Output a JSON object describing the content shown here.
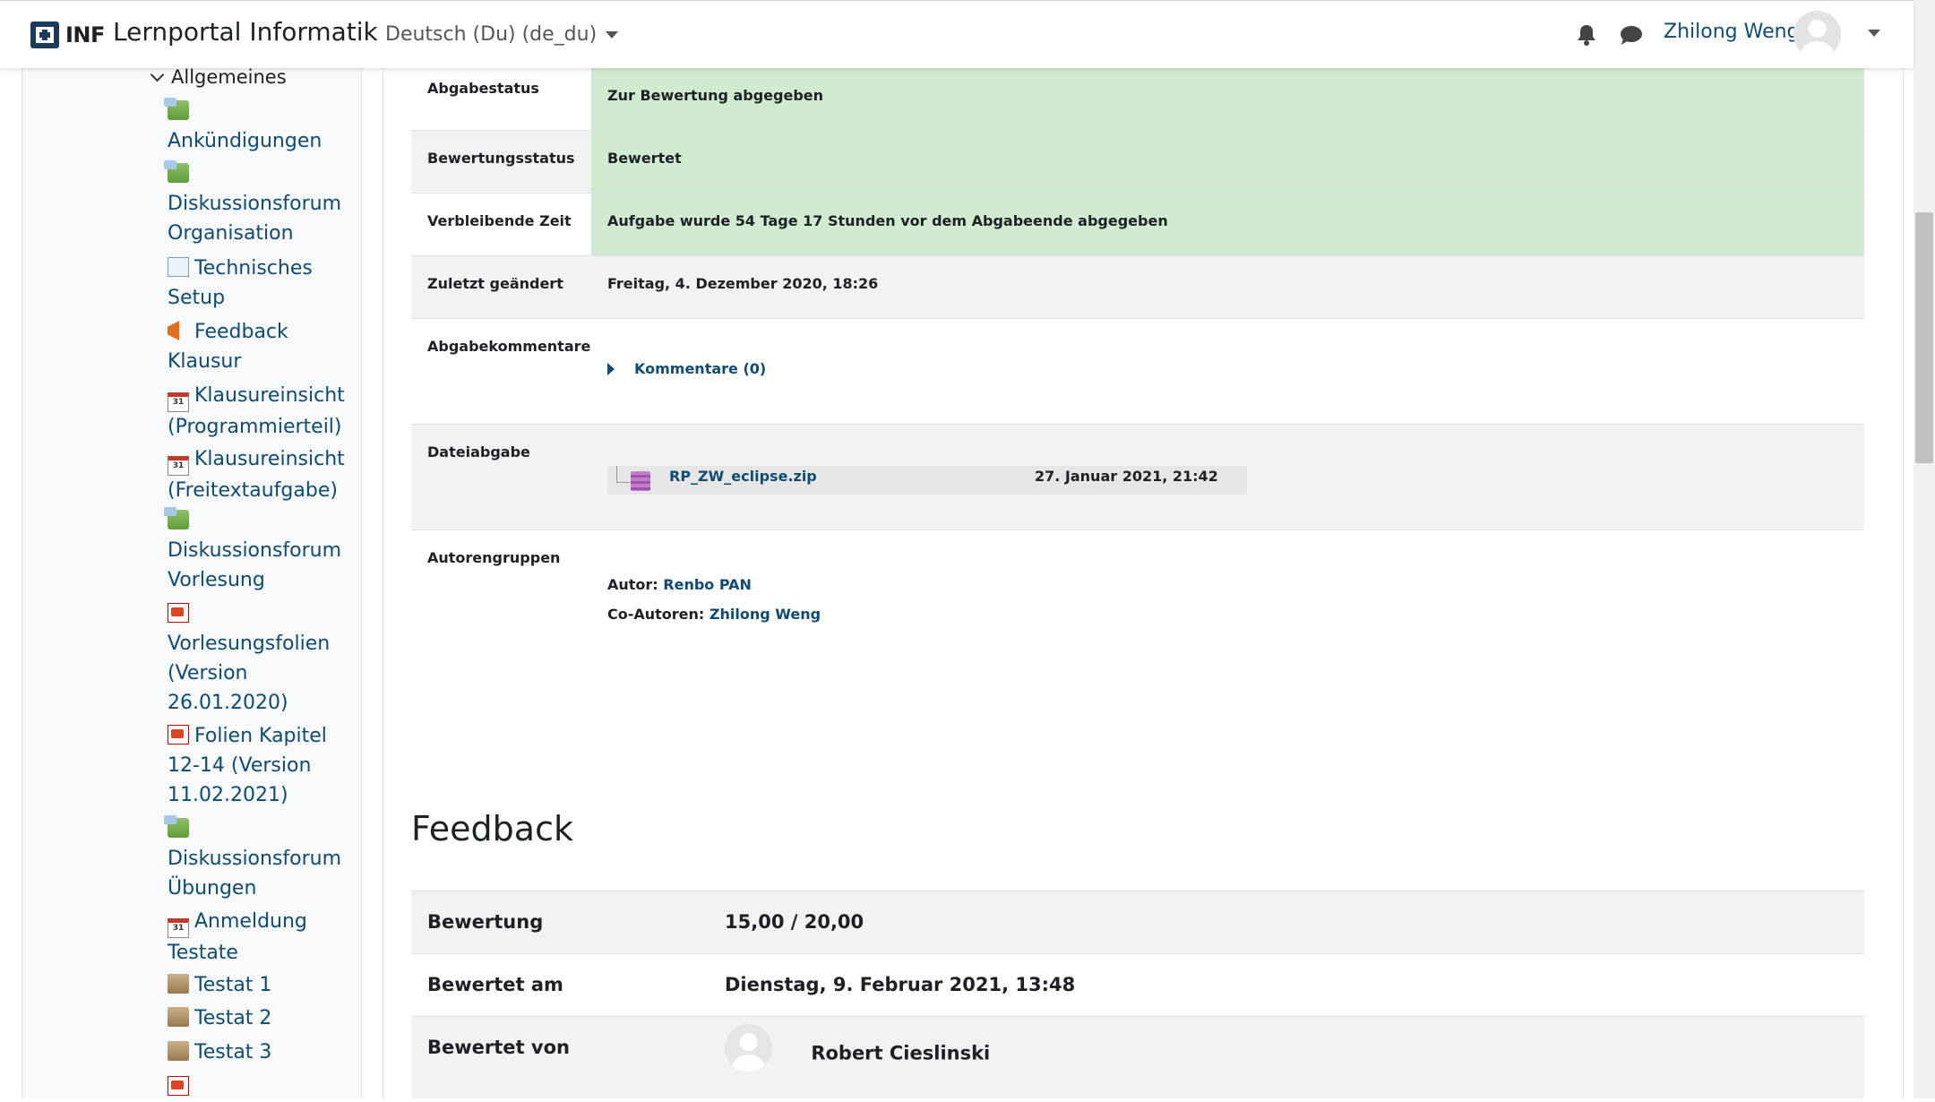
{
  "header": {
    "logo_text": "INF",
    "site_name": "Lernportal Informatik",
    "language": "Deutsch (Du) (de_du)",
    "user_name": "Zhilong Weng"
  },
  "sidebar": {
    "section": "Allgemeines",
    "items": [
      {
        "label": "Ankündigungen",
        "icon": "forum-icon"
      },
      {
        "label": "Diskussionsforum Organisation",
        "icon": "forum-icon"
      },
      {
        "label": "Technisches Setup",
        "icon": "choice-icon"
      },
      {
        "label": "Feedback Klausur",
        "icon": "feedback-icon"
      },
      {
        "label": "Klausureinsicht (Programmierteil)",
        "icon": "calendar-icon"
      },
      {
        "label": "Klausureinsicht (Freitextaufgabe)",
        "icon": "calendar-icon"
      },
      {
        "label": "Diskussionsforum Vorlesung",
        "icon": "forum-icon"
      },
      {
        "label": "Vorlesungsfolien (Version 26.01.2020)",
        "icon": "pdf-icon"
      },
      {
        "label": "Folien Kapitel 12-14 (Version 11.02.2021)",
        "icon": "pdf-icon"
      },
      {
        "label": "Diskussionsforum Übungen",
        "icon": "forum-icon"
      },
      {
        "label": "Anmeldung Testate",
        "icon": "calendar-icon"
      },
      {
        "label": "Testat 1",
        "icon": "quiz-icon"
      },
      {
        "label": "Testat 2",
        "icon": "quiz-icon"
      },
      {
        "label": "Testat 3",
        "icon": "quiz-icon"
      }
    ]
  },
  "submission": {
    "status_label": "Abgabestatus",
    "status_value": "Zur Bewertung abgegeben",
    "grading_label": "Bewertungsstatus",
    "grading_value": "Bewertet",
    "time_label": "Verbleibende Zeit",
    "time_value": "Aufgabe wurde 54 Tage 17 Stunden vor dem Abgabeende abgegeben",
    "modified_label": "Zuletzt geändert",
    "modified_value": "Freitag, 4. Dezember 2020, 18:26",
    "comments_label": "Abgabekommentare",
    "comments_link": "Kommentare (0)",
    "file_label": "Dateiabgabe",
    "file_name": "RP_ZW_eclipse.zip",
    "file_date": "27. Januar 2021, 21:42",
    "groups_label": "Autorengruppen",
    "author_prefix": "Autor:",
    "author_name": "Renbo PAN",
    "coauthor_prefix": "Co-Autoren:",
    "coauthor_name": "Zhilong Weng"
  },
  "feedback": {
    "title": "Feedback",
    "grade_label": "Bewertung",
    "grade_value": "15,00 / 20,00",
    "graded_on_label": "Bewertet am",
    "graded_on_value": "Dienstag, 9. Februar 2021, 13:48",
    "graded_by_label": "Bewertet von",
    "graded_by_value": "Robert Cieslinski"
  }
}
